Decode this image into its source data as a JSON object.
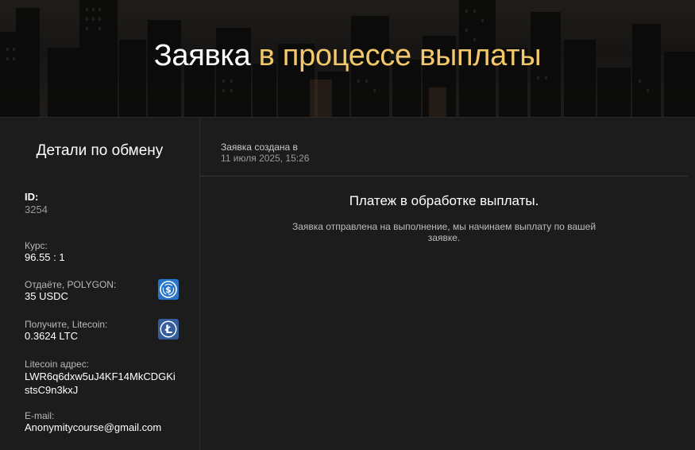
{
  "hero": {
    "title_main": "Заявка",
    "title_accent": "в процессе выплаты"
  },
  "details": {
    "title": "Детали по обмену",
    "id_label": "ID:",
    "id_value": "3254",
    "rate_label": "Курс:",
    "rate_value": "96.55 : 1",
    "give_label": "Отдаёте, POLYGON:",
    "give_value": "35 USDC",
    "give_icon": "usdc-coin-icon",
    "receive_label": "Получите, Litecoin:",
    "receive_value": "0.3624 LTC",
    "receive_icon": "litecoin-icon",
    "address_label": "Litecoin адрес:",
    "address_value": "LWR6q6dxw5uJ4KF14MkCDGKistsC9n3kxJ",
    "email_label": "E-mail:",
    "email_value": "Anonymitycourse@gmail.com"
  },
  "status": {
    "created_label": "Заявка создана в",
    "created_date": "11 июля 2025, 15:26",
    "title": "Платеж в обработке выплаты.",
    "message": "Заявка отправлена на выполнение, мы начинаем выплату по вашей заявке."
  },
  "colors": {
    "accent": "#f2c86a",
    "background": "#141414",
    "card": "#1c1c1c",
    "usdc_blue": "#2775ca",
    "ltc_blue": "#345d9d"
  }
}
